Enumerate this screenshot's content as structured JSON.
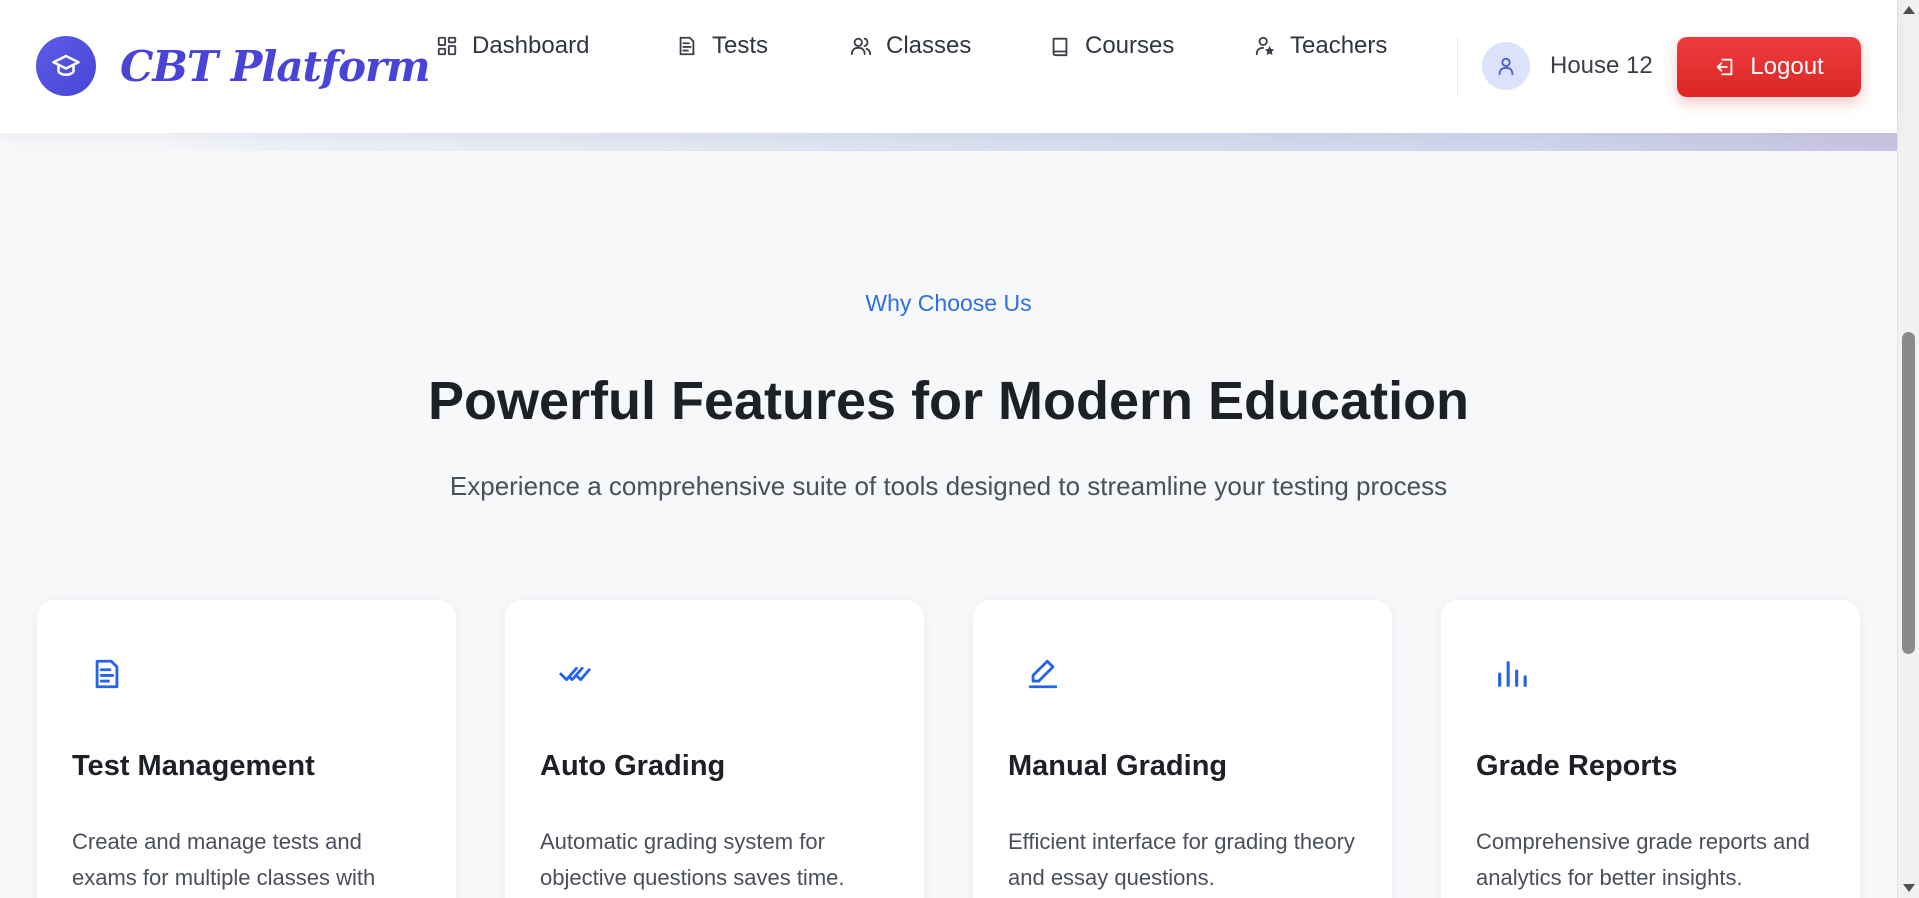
{
  "header": {
    "logo_icon": "graduation-cap-icon",
    "brand": "CBT Platform",
    "nav": [
      {
        "label": "Dashboard",
        "icon": "grid-icon"
      },
      {
        "label": "Tests",
        "icon": "document-icon"
      },
      {
        "label": "Classes",
        "icon": "users-icon"
      },
      {
        "label": "Courses",
        "icon": "book-icon"
      },
      {
        "label": "Teachers",
        "icon": "user-star-icon"
      }
    ],
    "user": {
      "name": "House 12",
      "icon": "user-icon"
    },
    "logout_label": "Logout",
    "logout_icon": "logout-icon"
  },
  "features": {
    "eyebrow": "Why Choose Us",
    "title": "Powerful Features for Modern Education",
    "subtitle": "Experience a comprehensive suite of tools designed to streamline your testing process",
    "cards": [
      {
        "icon": "file-list-icon",
        "title": "Test Management",
        "desc": "Create and manage tests and exams for multiple classes with"
      },
      {
        "icon": "double-check-icon",
        "title": "Auto Grading",
        "desc": "Automatic grading system for objective questions saves time."
      },
      {
        "icon": "pencil-icon",
        "title": "Manual Grading",
        "desc": "Efficient interface for grading theory and essay questions."
      },
      {
        "icon": "bar-chart-icon",
        "title": "Grade Reports",
        "desc": "Comprehensive grade reports and analytics for better insights."
      }
    ]
  },
  "colors": {
    "brand": "#4a44d6",
    "accent_blue": "#2f6fe4",
    "logout_red": "#dc2626"
  }
}
